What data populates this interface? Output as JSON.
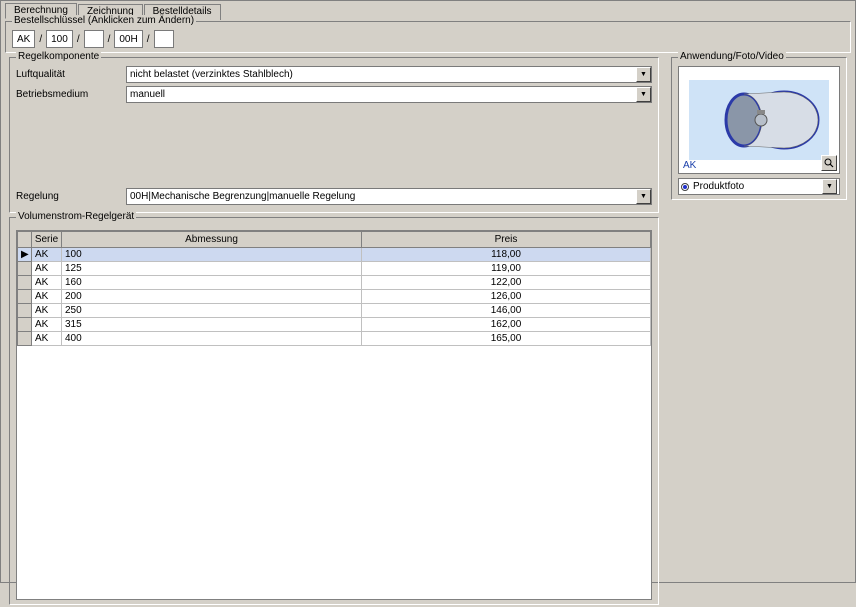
{
  "tabs": {
    "t0": "Berechnung",
    "t1": "Zeichnung",
    "t2": "Bestelldetails"
  },
  "orderkey": {
    "legend": "Bestellschlüssel (Anklicken zum Ändern)",
    "p0": "AK",
    "p1": "100",
    "p2": "",
    "p3": "00H",
    "p4": ""
  },
  "regel": {
    "legend": "Regelkomponente",
    "luft_label": "Luftqualität",
    "luft_value": "nicht belastet (verzinktes Stahlblech)",
    "betrieb_label": "Betriebsmedium",
    "betrieb_value": "manuell",
    "regelung_label": "Regelung",
    "regelung_value": "00H|Mechanische Begrenzung|manuelle Regelung"
  },
  "media": {
    "legend": "Anwendung/Foto/Video",
    "caption": "AK",
    "radio_label": "Produktfoto"
  },
  "table": {
    "legend": "Volumenstrom-Regelgerät",
    "h_serie": "Serie",
    "h_abm": "Abmessung",
    "h_preis": "Preis",
    "rows": [
      {
        "serie": "AK",
        "abm": "100",
        "preis": "118,00",
        "selected": true
      },
      {
        "serie": "AK",
        "abm": "125",
        "preis": "119,00"
      },
      {
        "serie": "AK",
        "abm": "160",
        "preis": "122,00"
      },
      {
        "serie": "AK",
        "abm": "200",
        "preis": "126,00"
      },
      {
        "serie": "AK",
        "abm": "250",
        "preis": "146,00"
      },
      {
        "serie": "AK",
        "abm": "315",
        "preis": "162,00"
      },
      {
        "serie": "AK",
        "abm": "400",
        "preis": "165,00"
      }
    ]
  }
}
